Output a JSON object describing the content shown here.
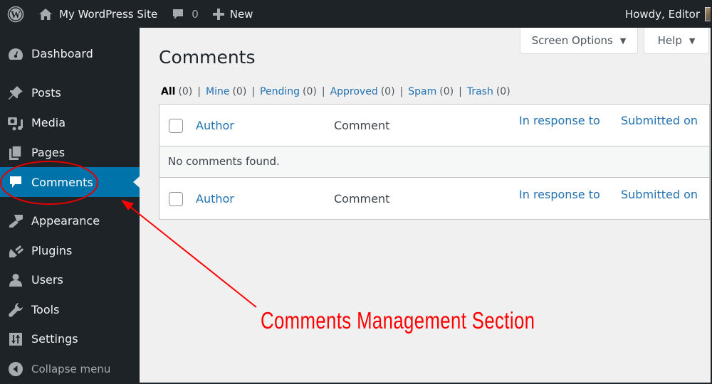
{
  "adminbar": {
    "logo_icon": "wordpress-logo-icon",
    "site_name": "My WordPress Site",
    "site_icon": "home-icon",
    "comments_icon": "comment-bubble-icon",
    "comments_count": "0",
    "new_icon": "plus-icon",
    "new_label": "New",
    "greeting": "Howdy, Editor"
  },
  "sidebar": {
    "items": [
      {
        "label": "Dashboard",
        "icon": "dashboard-gauge-icon"
      },
      {
        "label": "Posts",
        "icon": "pushpin-icon"
      },
      {
        "label": "Media",
        "icon": "media-camera-music-icon"
      },
      {
        "label": "Pages",
        "icon": "pages-icon"
      },
      {
        "label": "Comments",
        "icon": "comment-bubble-icon",
        "active": true
      },
      {
        "label": "Appearance",
        "icon": "paintbrush-icon"
      },
      {
        "label": "Plugins",
        "icon": "plug-icon"
      },
      {
        "label": "Users",
        "icon": "user-icon"
      },
      {
        "label": "Tools",
        "icon": "wrench-icon"
      },
      {
        "label": "Settings",
        "icon": "settings-sliders-icon"
      }
    ],
    "collapse_label": "Collapse menu",
    "collapse_icon": "collapse-arrow-icon"
  },
  "screen_meta": {
    "screen_options_label": "Screen Options",
    "help_label": "Help",
    "arrow": "▼"
  },
  "page": {
    "title": "Comments",
    "filters": [
      {
        "label": "All",
        "count": "(0)",
        "current": true
      },
      {
        "label": "Mine",
        "count": "(0)"
      },
      {
        "label": "Pending",
        "count": "(0)"
      },
      {
        "label": "Approved",
        "count": "(0)"
      },
      {
        "label": "Spam",
        "count": "(0)"
      },
      {
        "label": "Trash",
        "count": "(0)"
      }
    ],
    "separator": "|"
  },
  "table": {
    "columns": {
      "author": "Author",
      "comment": "Comment",
      "in_response_to": "In response to",
      "submitted_on": "Submitted on"
    },
    "empty_message": "No comments found."
  },
  "annotation": {
    "text": "Comments Management Section",
    "color": "#ff0000"
  },
  "colors": {
    "adminbar_bg": "#1d2327",
    "sidebar_bg": "#1d2327",
    "active_menu_bg": "#0073aa",
    "link": "#2271b1",
    "page_bg": "#f0f0f1"
  }
}
